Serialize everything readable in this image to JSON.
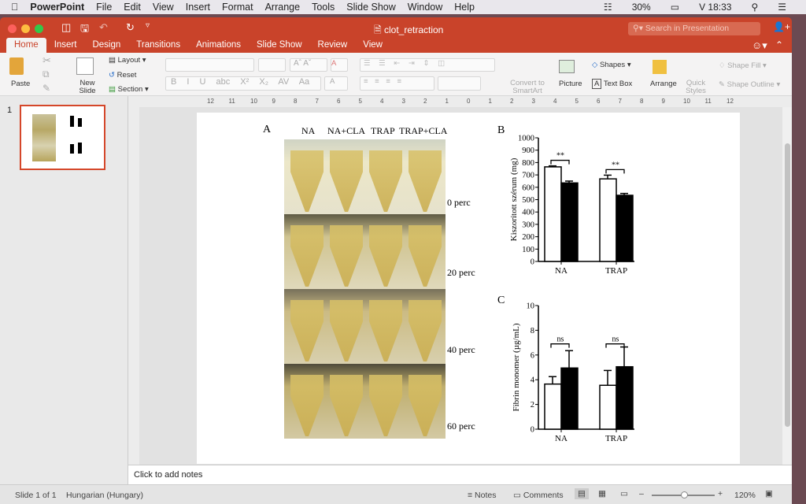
{
  "menubar": {
    "apple": "",
    "app": "PowerPoint",
    "items": [
      "File",
      "Edit",
      "View",
      "Insert",
      "Format",
      "Arrange",
      "Tools",
      "Slide Show",
      "Window",
      "Help"
    ],
    "battery": "30%",
    "clock": "V 18:33"
  },
  "window": {
    "title": "clot_retraction",
    "search_placeholder": "Search in Presentation"
  },
  "tabs": [
    "Home",
    "Insert",
    "Design",
    "Transitions",
    "Animations",
    "Slide Show",
    "Review",
    "View"
  ],
  "ribbon": {
    "paste": "Paste",
    "new_slide": "New Slide",
    "layout": "Layout",
    "reset": "Reset",
    "section": "Section",
    "convert": "Convert to SmartArt",
    "picture": "Picture",
    "shapes": "Shapes",
    "text_box": "Text Box",
    "arrange": "Arrange",
    "quick_styles": "Quick Styles",
    "shape_fill": "Shape Fill",
    "shape_outline": "Shape Outline"
  },
  "ruler": [
    "12",
    "11",
    "10",
    "9",
    "8",
    "7",
    "6",
    "5",
    "4",
    "3",
    "2",
    "1",
    "0",
    "1",
    "2",
    "3",
    "4",
    "5",
    "6",
    "7",
    "8",
    "9",
    "10",
    "11",
    "12"
  ],
  "thumbnail": {
    "number": "1"
  },
  "slide": {
    "panel_a": {
      "letter": "A",
      "columns": [
        "NA",
        "NA+CLA",
        "TRAP",
        "TRAP+CLA"
      ],
      "rows": [
        "0 perc",
        "20 perc",
        "40 perc",
        "60 perc"
      ]
    },
    "panel_b": {
      "letter": "B"
    },
    "panel_c": {
      "letter": "C"
    }
  },
  "chart_data": [
    {
      "type": "bar",
      "panel": "B",
      "categories": [
        "NA",
        "TRAP"
      ],
      "ylabel": "Kiszorított szérum (mg)",
      "ylim": [
        0,
        1000
      ],
      "yticks": [
        0,
        100,
        200,
        300,
        400,
        500,
        600,
        700,
        800,
        900,
        1000
      ],
      "series": [
        {
          "color": "#ffffff",
          "values": [
            765,
            668
          ],
          "errors": [
            8,
            30
          ]
        },
        {
          "color": "#000000",
          "values": [
            635,
            535
          ],
          "errors": [
            15,
            15
          ]
        }
      ],
      "annotations": [
        "**",
        "**"
      ]
    },
    {
      "type": "bar",
      "panel": "C",
      "categories": [
        "NA",
        "TRAP"
      ],
      "ylabel": "Fibrin monomer (µg/mL)",
      "ylim": [
        0,
        10
      ],
      "yticks": [
        0,
        2,
        4,
        6,
        8,
        10
      ],
      "series": [
        {
          "color": "#ffffff",
          "values": [
            3.65,
            3.55
          ],
          "errors": [
            0.6,
            1.2
          ]
        },
        {
          "color": "#000000",
          "values": [
            4.95,
            5.05
          ],
          "errors": [
            1.4,
            1.6
          ]
        }
      ],
      "annotations": [
        "ns",
        "ns"
      ]
    }
  ],
  "notes": {
    "placeholder": "Click to add notes"
  },
  "status": {
    "slide": "Slide 1 of 1",
    "language": "Hungarian (Hungary)",
    "notes": "Notes",
    "comments": "Comments",
    "zoom": "120%"
  }
}
